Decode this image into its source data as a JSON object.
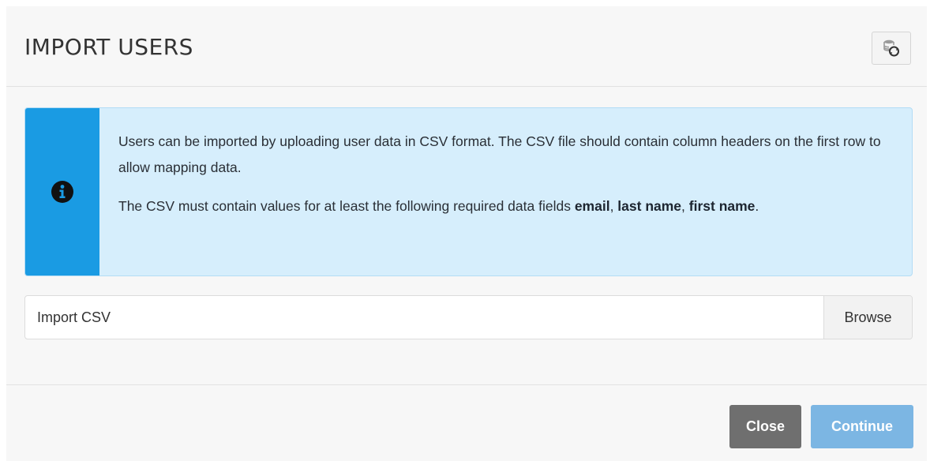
{
  "modal": {
    "title": "IMPORT USERS",
    "refresh_icon": "database-refresh-icon"
  },
  "alert": {
    "icon": "info-circle-icon",
    "paragraph1": "Users can be imported by uploading user data in CSV format. The CSV file should contain column headers on the first row to allow mapping data.",
    "paragraph2_prefix": "The CSV must contain values for at least the following required data fields ",
    "field1": "email",
    "sep1": ", ",
    "field2": "last name",
    "sep2": ", ",
    "field3": "first name",
    "suffix": "."
  },
  "file_input": {
    "label": "Import CSV",
    "browse_label": "Browse"
  },
  "footer": {
    "close_label": "Close",
    "continue_label": "Continue"
  },
  "colors": {
    "alert_accent": "#1a9be3",
    "alert_background": "#d6eefc",
    "close_button": "#6f6f6f",
    "continue_button": "#7cb6e3"
  }
}
